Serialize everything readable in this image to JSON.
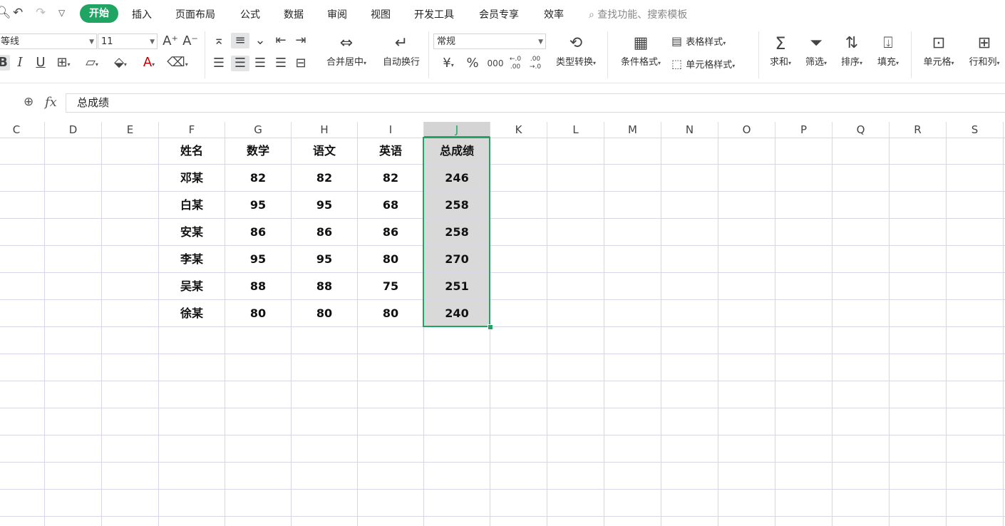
{
  "menu": {
    "active": "开始",
    "items": [
      "插入",
      "页面布局",
      "公式",
      "数据",
      "审阅",
      "视图",
      "开发工具",
      "会员专享",
      "效率"
    ],
    "search_placeholder": "查找功能、搜索模板"
  },
  "ribbon": {
    "font_name": "等线",
    "font_size": "11",
    "number_format": "常规",
    "merge_label": "合并居中",
    "wrap_label": "自动换行",
    "convert_label": "类型转换",
    "cond_format_label": "条件格式",
    "table_style_label": "表格样式",
    "cell_style_label": "单元格样式",
    "sum_label": "求和",
    "filter_label": "筛选",
    "sort_label": "排序",
    "fill_label": "填充",
    "cell_label": "单元格",
    "rowcol_label": "行和列",
    "currency_symbol": "¥",
    "percent_symbol": "%",
    "thousands_symbol": "000",
    "increase_decimal": "←.0 .00",
    "decrease_decimal": ".00 →.0"
  },
  "formula_bar": {
    "fx": "fx",
    "content": "总成绩"
  },
  "columns": [
    "C",
    "D",
    "E",
    "F",
    "G",
    "H",
    "I",
    "J",
    "K",
    "L",
    "M",
    "N",
    "O",
    "P",
    "Q",
    "R",
    "S"
  ],
  "selected_column": "J",
  "table": {
    "headers": [
      "姓名",
      "数学",
      "语文",
      "英语",
      "总成绩"
    ],
    "rows": [
      [
        "邓某",
        "82",
        "82",
        "82",
        "246"
      ],
      [
        "白某",
        "95",
        "95",
        "68",
        "258"
      ],
      [
        "安某",
        "86",
        "86",
        "86",
        "258"
      ],
      [
        "李某",
        "95",
        "95",
        "80",
        "270"
      ],
      [
        "吴某",
        "88",
        "88",
        "75",
        "251"
      ],
      [
        "徐某",
        "80",
        "80",
        "80",
        "240"
      ]
    ]
  },
  "colors": {
    "accent": "#1fa463",
    "grid": "#d6d6e6",
    "selection_fill": "#d9d9d9"
  }
}
